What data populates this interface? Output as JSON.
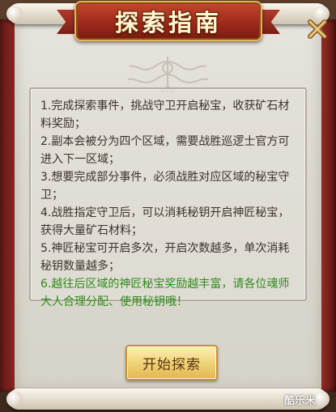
{
  "dialog": {
    "title": "探索指南",
    "close_icon": "close-x-icon",
    "guide_items": [
      "1.完成探索事件，挑战守卫开启秘宝，收获矿石材料奖励；",
      "2.副本会被分为四个区域，需要战胜巡逻士官方可进入下一区域；",
      "3.想要完成部分事件，必须战胜对应区域的秘宝守卫；",
      "4.战胜指定守卫后，可以消耗秘钥开启神匠秘宝，获得大量矿石材料；",
      "5.神匠秘宝可开启多次，开启次数越多，单次消耗秘钥数量越多；",
      "6.越往后区域的神匠秘宝奖励越丰富，请各位魂师大人合理分配、使用秘钥哦！"
    ],
    "highlight_color": "#2f8b1a",
    "start_button_label": "开始探索"
  },
  "watermark": "酷乐米"
}
